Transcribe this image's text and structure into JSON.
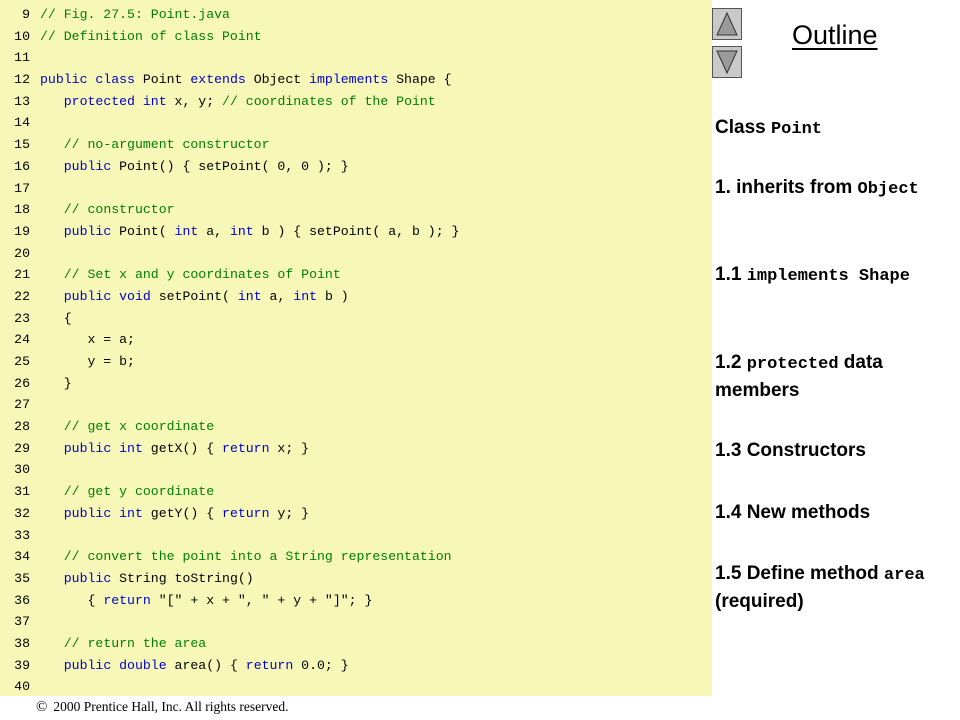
{
  "code": {
    "lines": [
      {
        "num": "9",
        "segments": [
          {
            "t": "// Fig. 27.5: Point.java",
            "c": "cm"
          }
        ]
      },
      {
        "num": "10",
        "segments": [
          {
            "t": "// Definition of class Point",
            "c": "cm"
          }
        ]
      },
      {
        "num": "11",
        "segments": []
      },
      {
        "num": "12",
        "segments": [
          {
            "t": "public class",
            "c": "kw"
          },
          {
            "t": " Point ",
            "c": ""
          },
          {
            "t": "extends",
            "c": "kw"
          },
          {
            "t": " Object ",
            "c": ""
          },
          {
            "t": "implements",
            "c": "kw"
          },
          {
            "t": " Shape {",
            "c": ""
          }
        ]
      },
      {
        "num": "13",
        "segments": [
          {
            "t": "   ",
            "c": ""
          },
          {
            "t": "protected int",
            "c": "kw"
          },
          {
            "t": " x, y; ",
            "c": ""
          },
          {
            "t": "// coordinates of the Point",
            "c": "cm"
          }
        ]
      },
      {
        "num": "14",
        "segments": []
      },
      {
        "num": "15",
        "segments": [
          {
            "t": "   ",
            "c": ""
          },
          {
            "t": "// no-argument constructor",
            "c": "cm"
          }
        ]
      },
      {
        "num": "16",
        "segments": [
          {
            "t": "   ",
            "c": ""
          },
          {
            "t": "public",
            "c": "kw"
          },
          {
            "t": " Point() { setPoint( 0, 0 ); }",
            "c": ""
          }
        ]
      },
      {
        "num": "17",
        "segments": []
      },
      {
        "num": "18",
        "segments": [
          {
            "t": "   ",
            "c": ""
          },
          {
            "t": "// constructor",
            "c": "cm"
          }
        ]
      },
      {
        "num": "19",
        "segments": [
          {
            "t": "   ",
            "c": ""
          },
          {
            "t": "public",
            "c": "kw"
          },
          {
            "t": " Point( ",
            "c": ""
          },
          {
            "t": "int",
            "c": "kw"
          },
          {
            "t": " a, ",
            "c": ""
          },
          {
            "t": "int",
            "c": "kw"
          },
          {
            "t": " b ) { setPoint( a, b ); }",
            "c": ""
          }
        ]
      },
      {
        "num": "20",
        "segments": []
      },
      {
        "num": "21",
        "segments": [
          {
            "t": "   ",
            "c": ""
          },
          {
            "t": "// Set x and y coordinates of Point",
            "c": "cm"
          }
        ]
      },
      {
        "num": "22",
        "segments": [
          {
            "t": "   ",
            "c": ""
          },
          {
            "t": "public void",
            "c": "kw"
          },
          {
            "t": " setPoint( ",
            "c": ""
          },
          {
            "t": "int",
            "c": "kw"
          },
          {
            "t": " a, ",
            "c": ""
          },
          {
            "t": "int",
            "c": "kw"
          },
          {
            "t": " b )",
            "c": ""
          }
        ]
      },
      {
        "num": "23",
        "segments": [
          {
            "t": "   {",
            "c": ""
          }
        ]
      },
      {
        "num": "24",
        "segments": [
          {
            "t": "      x = a;",
            "c": ""
          }
        ]
      },
      {
        "num": "25",
        "segments": [
          {
            "t": "      y = b;",
            "c": ""
          }
        ]
      },
      {
        "num": "26",
        "segments": [
          {
            "t": "   }",
            "c": ""
          }
        ]
      },
      {
        "num": "27",
        "segments": []
      },
      {
        "num": "28",
        "segments": [
          {
            "t": "   ",
            "c": ""
          },
          {
            "t": "// get x coordinate",
            "c": "cm"
          }
        ]
      },
      {
        "num": "29",
        "segments": [
          {
            "t": "   ",
            "c": ""
          },
          {
            "t": "public int",
            "c": "kw"
          },
          {
            "t": " getX() { ",
            "c": ""
          },
          {
            "t": "return",
            "c": "kw"
          },
          {
            "t": " x; }",
            "c": ""
          }
        ]
      },
      {
        "num": "30",
        "segments": []
      },
      {
        "num": "31",
        "segments": [
          {
            "t": "   ",
            "c": ""
          },
          {
            "t": "// get y coordinate",
            "c": "cm"
          }
        ]
      },
      {
        "num": "32",
        "segments": [
          {
            "t": "   ",
            "c": ""
          },
          {
            "t": "public int",
            "c": "kw"
          },
          {
            "t": " getY() { ",
            "c": ""
          },
          {
            "t": "return",
            "c": "kw"
          },
          {
            "t": " y; }",
            "c": ""
          }
        ]
      },
      {
        "num": "33",
        "segments": []
      },
      {
        "num": "34",
        "segments": [
          {
            "t": "   ",
            "c": ""
          },
          {
            "t": "// convert the point into a String representation",
            "c": "cm"
          }
        ]
      },
      {
        "num": "35",
        "segments": [
          {
            "t": "   ",
            "c": ""
          },
          {
            "t": "public",
            "c": "kw"
          },
          {
            "t": " String toString()",
            "c": ""
          }
        ]
      },
      {
        "num": "36",
        "segments": [
          {
            "t": "      { ",
            "c": ""
          },
          {
            "t": "return",
            "c": "kw"
          },
          {
            "t": " \"[\" + x + \", \" + y + \"]\"; }",
            "c": ""
          }
        ]
      },
      {
        "num": "37",
        "segments": []
      },
      {
        "num": "38",
        "segments": [
          {
            "t": "   ",
            "c": ""
          },
          {
            "t": "// return the area",
            "c": "cm"
          }
        ]
      },
      {
        "num": "39",
        "segments": [
          {
            "t": "   ",
            "c": ""
          },
          {
            "t": "public double",
            "c": "kw"
          },
          {
            "t": " area() { ",
            "c": ""
          },
          {
            "t": "return",
            "c": "kw"
          },
          {
            "t": " 0.0; }",
            "c": ""
          }
        ]
      },
      {
        "num": "40",
        "segments": []
      }
    ]
  },
  "footer": {
    "symbol": "©",
    "text": "2000 Prentice Hall, Inc.  All rights reserved."
  },
  "nav": {
    "up_icon": "triangle-up-icon",
    "down_icon": "triangle-down-icon"
  },
  "outline": {
    "title": "Outline",
    "items": [
      {
        "parts": [
          {
            "t": "Class ",
            "mono": false
          },
          {
            "t": "Point",
            "mono": true
          }
        ]
      },
      {
        "parts": [
          {
            "t": "1. inherits from ",
            "mono": false
          },
          {
            "t": "Object",
            "mono": true
          }
        ]
      },
      {
        "parts": [
          {
            "t": "1.1 ",
            "mono": false
          },
          {
            "t": "implements Shape",
            "mono": true
          }
        ]
      },
      {
        "parts": [
          {
            "t": "1.2 ",
            "mono": false
          },
          {
            "t": "protected",
            "mono": true
          },
          {
            "t": " data members",
            "mono": false
          }
        ]
      },
      {
        "parts": [
          {
            "t": "1.3 Constructors",
            "mono": false
          }
        ]
      },
      {
        "parts": [
          {
            "t": "1.4 New methods",
            "mono": false
          }
        ]
      },
      {
        "parts": [
          {
            "t": "1.5 Define method ",
            "mono": false
          },
          {
            "t": "area",
            "mono": true
          },
          {
            "t": " (required)",
            "mono": false
          }
        ]
      }
    ]
  },
  "colors": {
    "code_bg": "#f7f7b8",
    "keyword": "#0000cc",
    "comment": "#008000"
  }
}
